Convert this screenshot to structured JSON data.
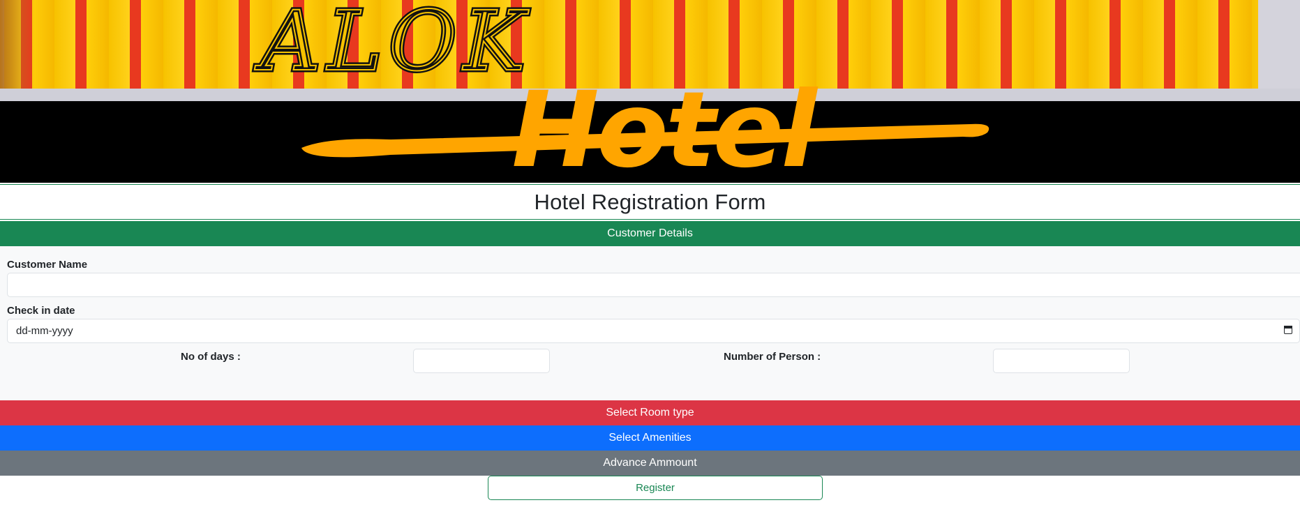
{
  "banner": {
    "logo_word_top": "ALOK",
    "logo_word_bottom": "Hotel",
    "colors": {
      "stripe_yellow": "#ffd21a",
      "stripe_red": "#e8391f",
      "hotel_orange": "#ffa500"
    }
  },
  "page": {
    "title": "Hotel Registration Form"
  },
  "sections": {
    "customer_details": "Customer Details",
    "room_type": "Select Room type",
    "amenities": "Select Amenities",
    "advance": "Advance Ammount"
  },
  "form": {
    "customer_name_label": "Customer Name",
    "customer_name_value": "",
    "checkin_label": "Check in date",
    "checkin_placeholder": "dd-mm-yyyy",
    "days_label": "No of days :",
    "days_value": "",
    "persons_label": "Number of Person :",
    "persons_value": ""
  },
  "actions": {
    "register_label": "Register"
  },
  "colors": {
    "success": "#198754",
    "danger": "#dc3545",
    "primary": "#0d6efd",
    "secondary": "#6c757d"
  }
}
